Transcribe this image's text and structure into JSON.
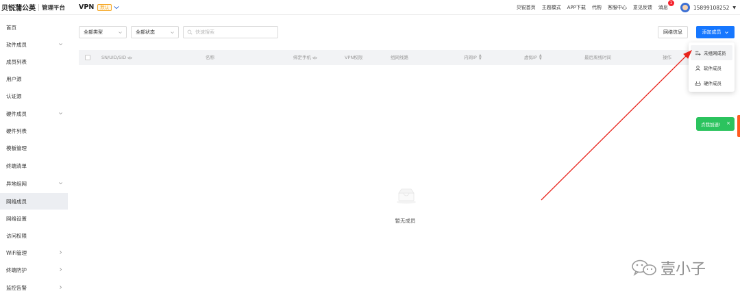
{
  "brand": {
    "name": "贝锐蒲公英",
    "subtitle": "管理平台"
  },
  "module": {
    "name": "VPN",
    "badge": "默认"
  },
  "topnav": {
    "links": [
      "贝锐首页",
      "主题模式",
      "APP下载",
      "代购",
      "客服中心",
      "意见反馈",
      "消息"
    ],
    "message_count": "1",
    "phone": "15899108252"
  },
  "sidebar": {
    "items": [
      {
        "label": "首页",
        "expandable": false
      },
      {
        "label": "软件成员",
        "expandable": true
      },
      {
        "label": "成员列表",
        "expandable": false
      },
      {
        "label": "用户源",
        "expandable": false
      },
      {
        "label": "认证源",
        "expandable": false
      },
      {
        "label": "硬件成员",
        "expandable": true
      },
      {
        "label": "硬件列表",
        "expandable": false
      },
      {
        "label": "模板管理",
        "expandable": false
      },
      {
        "label": "终端清单",
        "expandable": false
      },
      {
        "label": "异地组网",
        "expandable": true
      },
      {
        "label": "网络成员",
        "expandable": false,
        "active": true
      },
      {
        "label": "网络设置",
        "expandable": false
      },
      {
        "label": "访问权限",
        "expandable": false
      },
      {
        "label": "WiFi管理",
        "expandable": "right"
      },
      {
        "label": "终端防护",
        "expandable": "right"
      },
      {
        "label": "监控告警",
        "expandable": "right"
      }
    ]
  },
  "filters": {
    "type_select": "全部类型",
    "status_select": "全部状态",
    "search_placeholder": "快速搜索"
  },
  "buttons": {
    "network_info": "网络信息",
    "add_member": "添加成员"
  },
  "table": {
    "columns": [
      "SN/UID/SID",
      "名称",
      "绑定手机",
      "VPN权限",
      "组网线路",
      "内网IP",
      "虚拟IP",
      "最后离线时间",
      "操作"
    ],
    "empty_text": "暂无成员"
  },
  "dropdown": {
    "items": [
      "未组网成员",
      "软件成员",
      "硬件成员"
    ]
  },
  "toast": {
    "text": "点我加速!",
    "close": "×"
  },
  "watermark": {
    "text": "壹小子"
  },
  "colors": {
    "primary": "#1677ff",
    "toast": "#2bc35e",
    "badge": "#f5a623",
    "arrow": "#e8241c"
  }
}
